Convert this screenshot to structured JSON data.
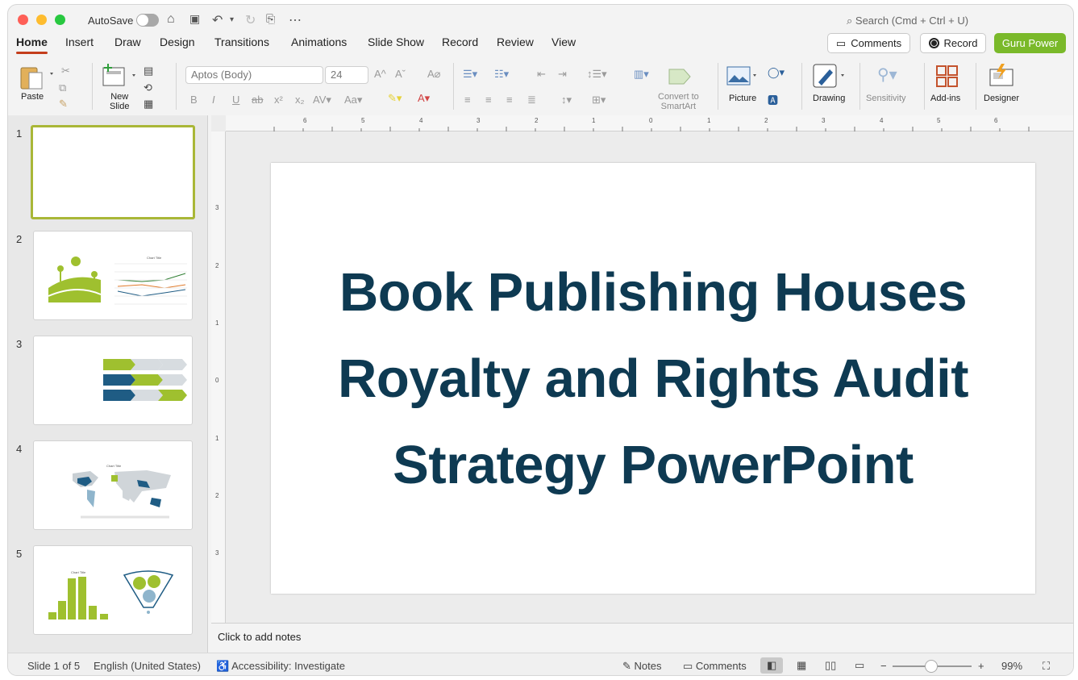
{
  "titlebar": {
    "autosave_label": "AutoSave",
    "search_placeholder": "Search (Cmd + Ctrl + U)"
  },
  "tabs": [
    "Home",
    "Insert",
    "Draw",
    "Design",
    "Transitions",
    "Animations",
    "Slide Show",
    "Record",
    "Review",
    "View"
  ],
  "actions": {
    "comments": "Comments",
    "record": "Record",
    "guru": "Guru Power"
  },
  "ribbon": {
    "paste": "Paste",
    "new_slide_1": "New",
    "new_slide_2": "Slide",
    "font_name": "Aptos (Body)",
    "font_size": "24",
    "smartart_1": "Convert to",
    "smartart_2": "SmartArt",
    "picture": "Picture",
    "drawing": "Drawing",
    "sensitivity": "Sensitivity",
    "addins": "Add-ins",
    "designer": "Designer"
  },
  "thumbnails": [
    "1",
    "2",
    "3",
    "4",
    "5"
  ],
  "thumb_captions": {
    "chart_title": "Chart Title"
  },
  "ruler": {
    "h": [
      "6",
      "5",
      "4",
      "3",
      "2",
      "1",
      "0",
      "1",
      "2",
      "3",
      "4",
      "5",
      "6"
    ],
    "v": [
      "3",
      "2",
      "1",
      "0",
      "1",
      "2",
      "3"
    ]
  },
  "slide": {
    "title": "Book Publishing Houses Royalty and Rights Audit Strategy PowerPoint"
  },
  "notes": {
    "placeholder": "Click to add notes"
  },
  "status": {
    "slide_count": "Slide 1 of 5",
    "language": "English (United States)",
    "accessibility": "Accessibility: Investigate",
    "notes": "Notes",
    "comments": "Comments",
    "zoom": "99%"
  },
  "colors": {
    "accent_green": "#7ab92a",
    "title_navy": "#0e3a52",
    "tab_underline": "#c43e1c",
    "thumb_select": "#a9b737"
  }
}
